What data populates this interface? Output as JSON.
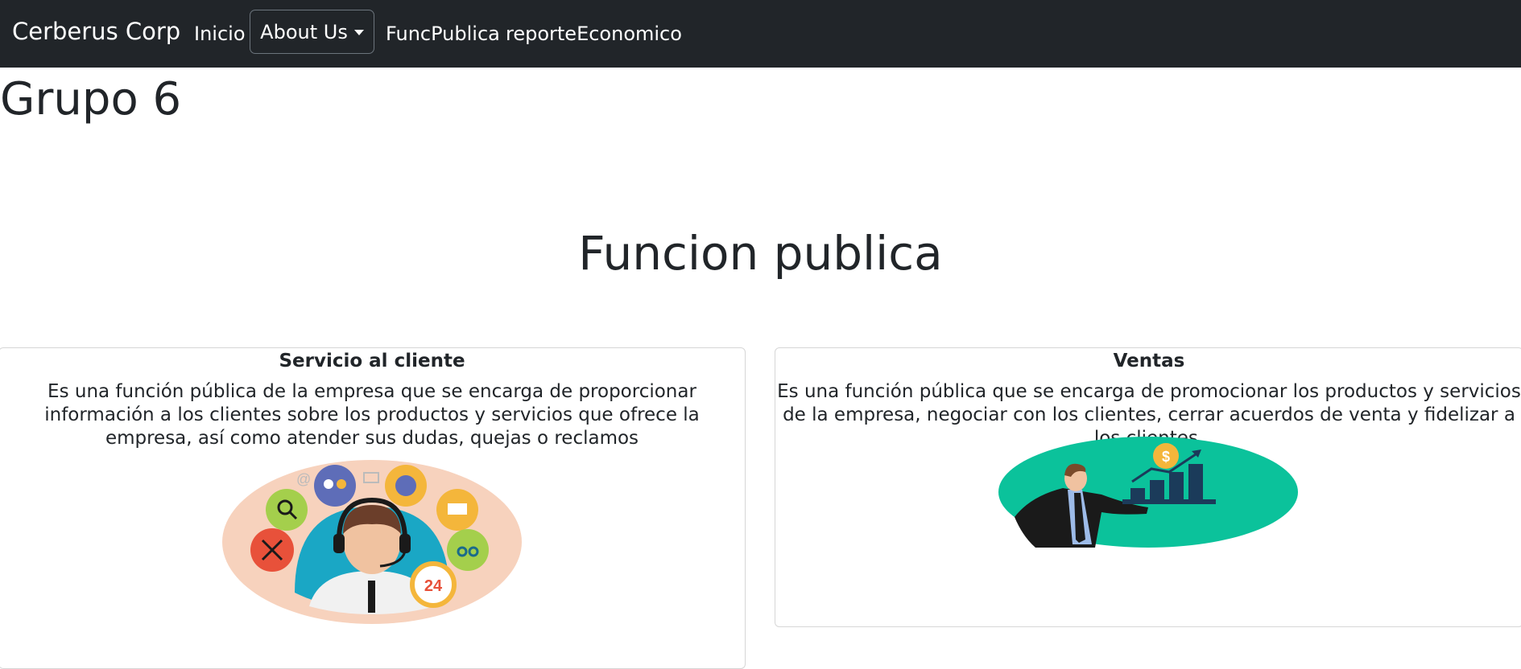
{
  "navbar": {
    "brand": "Cerberus Corp",
    "links": [
      "Inicio",
      "About Us",
      "FuncPublica",
      "reporteEconomico"
    ]
  },
  "page": {
    "group_title": "Grupo 6",
    "section_title": "Funcion publica"
  },
  "cards": [
    {
      "title": "Servicio al cliente",
      "text": "Es una función pública de la empresa que se encarga de proporcionar información a los clientes sobre los productos y servicios que ofrece la empresa, así como atender sus dudas, quejas o reclamos",
      "illustration_icon": "customer-service-agent-icon",
      "badge": "24"
    },
    {
      "title": "Ventas",
      "text": "Es una función pública que se encarga de promocionar los productos y servicios de la empresa, negociar con los clientes, cerrar acuerdos de venta y fidelizar a los clientes.",
      "illustration_icon": "sales-growth-icon",
      "badge": "$"
    }
  ],
  "colors": {
    "navbar_bg": "#212529",
    "text": "#212529",
    "peach": "#f7d2bd",
    "teal": "#1aa7c5",
    "green": "#0bc29b",
    "navy": "#1b3b5a"
  }
}
